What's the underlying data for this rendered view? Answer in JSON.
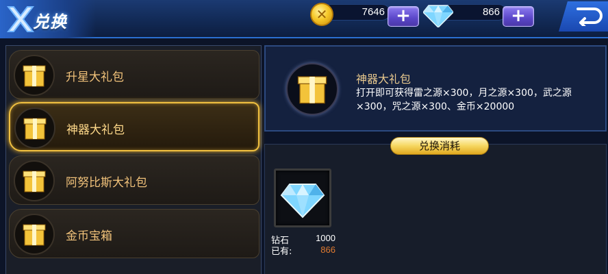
{
  "header": {
    "title": "兑换",
    "coins": "7646",
    "diamonds": "866",
    "coin_symbol": "✕",
    "plus_symbol": "+",
    "icons": [
      "x-logo-icon",
      "coin-icon",
      "diamond-icon",
      "back-arrow-icon"
    ],
    "accent": "#2b6fd0"
  },
  "packages": [
    {
      "label": "升星大礼包",
      "selected": false
    },
    {
      "label": "神器大礼包",
      "selected": true
    },
    {
      "label": "阿努比斯大礼包",
      "selected": false
    },
    {
      "label": "金币宝箱",
      "selected": false
    }
  ],
  "detail": {
    "name": "神器大礼包",
    "description": "打开即可获得雷之源×300，月之源×300，武之源×300，咒之源×300、金币×20000"
  },
  "cost": {
    "tab_label": "兑换消耗",
    "item_name": "钻石",
    "required": "1000",
    "owned_label": "已有:",
    "owned": "866",
    "owned_color": "#e07a30",
    "selected_border": "#f0c040"
  }
}
